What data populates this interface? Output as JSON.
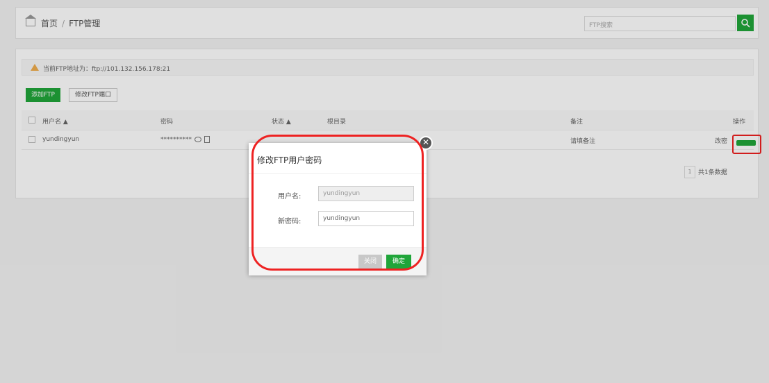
{
  "breadcrumb": {
    "home": "首页",
    "separator": "/",
    "current": "FTP管理"
  },
  "search": {
    "placeholder": "FTP搜索",
    "icon": "search-icon"
  },
  "notice": {
    "text": "当前FTP地址为：ftp://101.132.156.178:21",
    "icon": "warning-icon"
  },
  "toolbar": {
    "add_label": "添加FTP",
    "port_label": "修改FTP端口"
  },
  "table": {
    "headers": {
      "username": "用户名 ▲",
      "password": "密码",
      "status": "状态 ▲",
      "root": "根目录",
      "note": "备注",
      "action": "操作"
    },
    "rows": [
      {
        "username": "yundingyun",
        "password": "**********",
        "note": "请填备注",
        "action": "改密"
      }
    ]
  },
  "pager": {
    "page": "1",
    "total": "共1条数据"
  },
  "dialog": {
    "title": "修改FTP用户密码",
    "username_label": "用户名:",
    "username_value": "yundingyun",
    "password_label": "新密码:",
    "password_value": "yundingyun",
    "close_label": "关闭",
    "ok_label": "确定",
    "close_icon": "✕"
  },
  "colors": {
    "accent": "#20a53a",
    "highlight": "#e22222"
  }
}
